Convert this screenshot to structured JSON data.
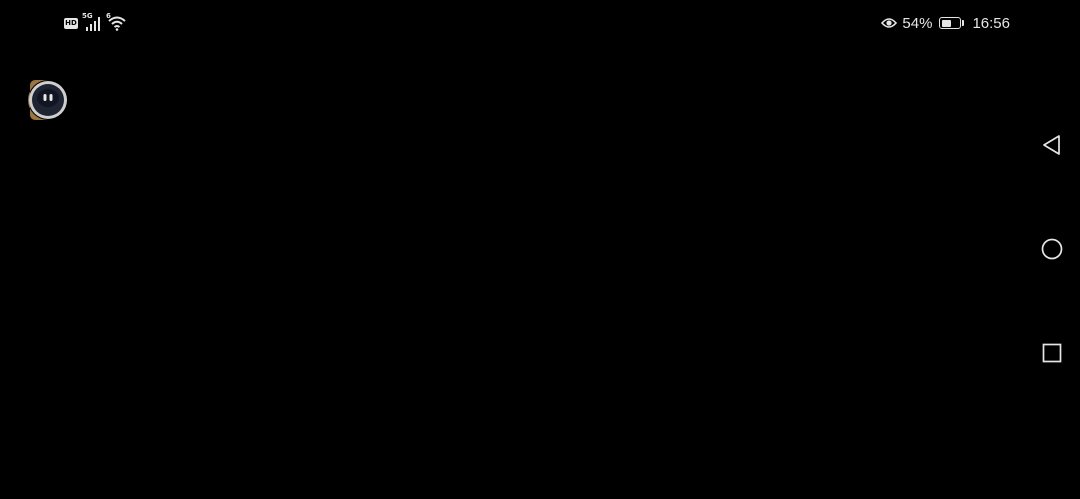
{
  "status_bar": {
    "hd_label": "HD",
    "network_label": "5G",
    "wifi_label": "6",
    "battery_percent_text": "54%",
    "battery_level": 0.54,
    "time": "16:56",
    "icons": [
      "hd-icon",
      "cell-signal-icon",
      "wifi-icon",
      "eye-comfort-icon",
      "battery-icon"
    ]
  },
  "floating_assistant": {
    "icon": "assistant-bubble-icon"
  },
  "navigation_bar": {
    "buttons": [
      {
        "name": "back",
        "icon": "triangle-back-icon"
      },
      {
        "name": "home",
        "icon": "circle-home-icon"
      },
      {
        "name": "recents",
        "icon": "square-recents-icon"
      }
    ]
  },
  "colors": {
    "background": "#000000",
    "foreground": "#e6e6e6"
  }
}
